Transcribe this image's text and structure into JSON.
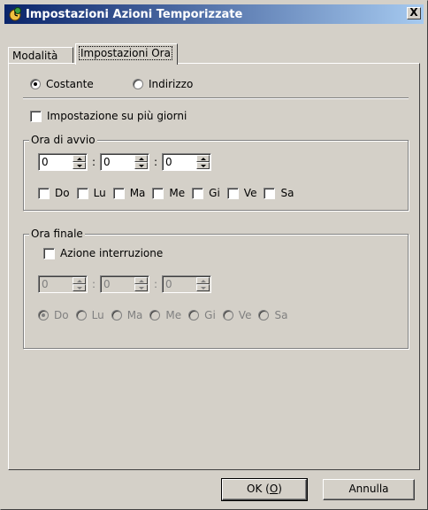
{
  "window": {
    "title": "Impostazioni Azioni Temporizzate",
    "close_label": "X"
  },
  "tabs": [
    {
      "label": "Modalità"
    },
    {
      "label": "Impostazioni Ora"
    }
  ],
  "mode": {
    "options": [
      {
        "label": "Costante",
        "checked": true
      },
      {
        "label": "Indirizzo",
        "checked": false
      }
    ]
  },
  "multi_day": {
    "label": "Impostazione su più giorni",
    "checked": false
  },
  "start_time": {
    "group_label": "Ora di avvio",
    "hours": "0",
    "minutes": "0",
    "seconds": "0",
    "separator": ":",
    "days": [
      "Do",
      "Lu",
      "Ma",
      "Me",
      "Gi",
      "Ve",
      "Sa"
    ]
  },
  "end_time": {
    "group_label": "Ora finale",
    "interrupt_label": "Azione interruzione",
    "hours": "0",
    "minutes": "0",
    "seconds": "0",
    "separator": ":",
    "days": [
      "Do",
      "Lu",
      "Ma",
      "Me",
      "Gi",
      "Ve",
      "Sa"
    ]
  },
  "buttons": {
    "ok_prefix": "OK (",
    "ok_mnemonic": "O",
    "ok_suffix": ")",
    "cancel": "Annulla"
  }
}
